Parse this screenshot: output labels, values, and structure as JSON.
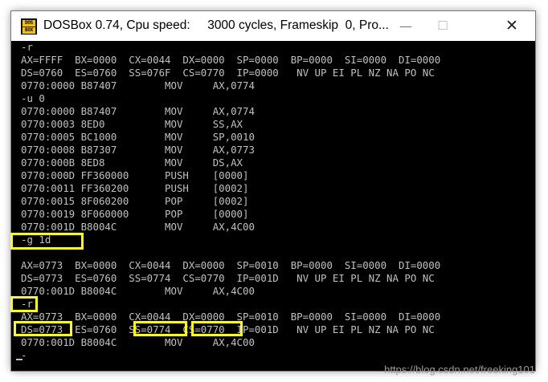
{
  "window": {
    "title": "DOSBox 0.74, Cpu speed:     3000 cycles, Frameskip  0, Pro...",
    "icon_top": "DOS",
    "icon_bottom": "BOX",
    "minimize_glyph": "—",
    "maximize_glyph": "☐",
    "close_glyph": "✕"
  },
  "terminal": {
    "lines": [
      "-r",
      "AX=FFFF  BX=0000  CX=0044  DX=0000  SP=0000  BP=0000  SI=0000  DI=0000",
      "DS=0760  ES=0760  SS=076F  CS=0770  IP=0000   NV UP EI PL NZ NA PO NC",
      "0770:0000 B87407        MOV     AX,0774",
      "-u 0",
      "0770:0000 B87407        MOV     AX,0774",
      "0770:0003 8ED0          MOV     SS,AX",
      "0770:0005 BC1000        MOV     SP,0010",
      "0770:0008 B87307        MOV     AX,0773",
      "0770:000B 8ED8          MOV     DS,AX",
      "0770:000D FF360000      PUSH    [0000]",
      "0770:0011 FF360200      PUSH    [0002]",
      "0770:0015 8F060200      POP     [0002]",
      "0770:0019 8F060000      POP     [0000]",
      "0770:001D B8004C        MOV     AX,4C00",
      "-g 1d",
      "",
      "AX=0773  BX=0000  CX=0044  DX=0000  SP=0010  BP=0000  SI=0000  DI=0000",
      "DS=0773  ES=0760  SS=0774  CS=0770  IP=001D   NV UP EI PL NZ NA PO NC",
      "0770:001D B8004C        MOV     AX,4C00",
      "-r",
      "AX=0773  BX=0000  CX=0044  DX=0000  SP=0010  BP=0000  SI=0000  DI=0000",
      "DS=0773  ES=0760  SS=0774  CS=0770  IP=001D   NV UP EI PL NZ NA PO NC",
      "0770:001D B8004C        MOV     AX,4C00",
      "-"
    ]
  },
  "watermark": "https://blog.csdn.net/freeking101",
  "colors": {
    "terminal_bg": "#000000",
    "terminal_text": "#c0c0c0",
    "highlight": "#ffff00",
    "titlebar_bg": "#ffffff"
  }
}
